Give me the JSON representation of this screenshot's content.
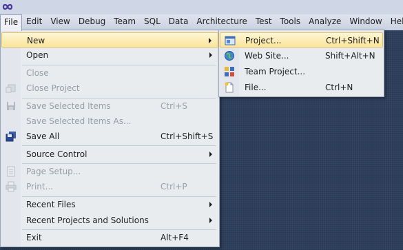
{
  "menubar": {
    "items": [
      "File",
      "Edit",
      "View",
      "Debug",
      "Team",
      "SQL",
      "Data",
      "Architecture",
      "Test",
      "Tools",
      "Analyze",
      "Window",
      "Help"
    ]
  },
  "file_menu": {
    "items": [
      {
        "label": "New",
        "shortcut": "",
        "submenu": true,
        "disabled": false,
        "icon": ""
      },
      {
        "label": "Open",
        "shortcut": "",
        "submenu": true,
        "disabled": false,
        "icon": ""
      },
      {
        "label": "Close",
        "shortcut": "",
        "submenu": false,
        "disabled": true,
        "icon": ""
      },
      {
        "label": "Close Project",
        "shortcut": "",
        "submenu": false,
        "disabled": true,
        "icon": "close-project-icon"
      },
      {
        "label": "Save Selected Items",
        "shortcut": "Ctrl+S",
        "submenu": false,
        "disabled": true,
        "icon": "save-icon"
      },
      {
        "label": "Save Selected Items As...",
        "shortcut": "",
        "submenu": false,
        "disabled": true,
        "icon": ""
      },
      {
        "label": "Save All",
        "shortcut": "Ctrl+Shift+S",
        "submenu": false,
        "disabled": false,
        "icon": "save-all-icon"
      },
      {
        "label": "Source Control",
        "shortcut": "",
        "submenu": true,
        "disabled": false,
        "icon": ""
      },
      {
        "label": "Page Setup...",
        "shortcut": "",
        "submenu": false,
        "disabled": true,
        "icon": "page-setup-icon"
      },
      {
        "label": "Print...",
        "shortcut": "Ctrl+P",
        "submenu": false,
        "disabled": true,
        "icon": "print-icon"
      },
      {
        "label": "Recent Files",
        "shortcut": "",
        "submenu": true,
        "disabled": false,
        "icon": ""
      },
      {
        "label": "Recent Projects and Solutions",
        "shortcut": "",
        "submenu": true,
        "disabled": false,
        "icon": ""
      },
      {
        "label": "Exit",
        "shortcut": "Alt+F4",
        "submenu": false,
        "disabled": false,
        "icon": ""
      }
    ]
  },
  "new_menu": {
    "items": [
      {
        "label": "Project...",
        "shortcut": "Ctrl+Shift+N",
        "icon": "new-project-icon"
      },
      {
        "label": "Web Site...",
        "shortcut": "Shift+Alt+N",
        "icon": "web-site-icon"
      },
      {
        "label": "Team Project...",
        "shortcut": "",
        "icon": "team-project-icon"
      },
      {
        "label": "File...",
        "shortcut": "Ctrl+N",
        "icon": "new-file-icon"
      }
    ]
  }
}
